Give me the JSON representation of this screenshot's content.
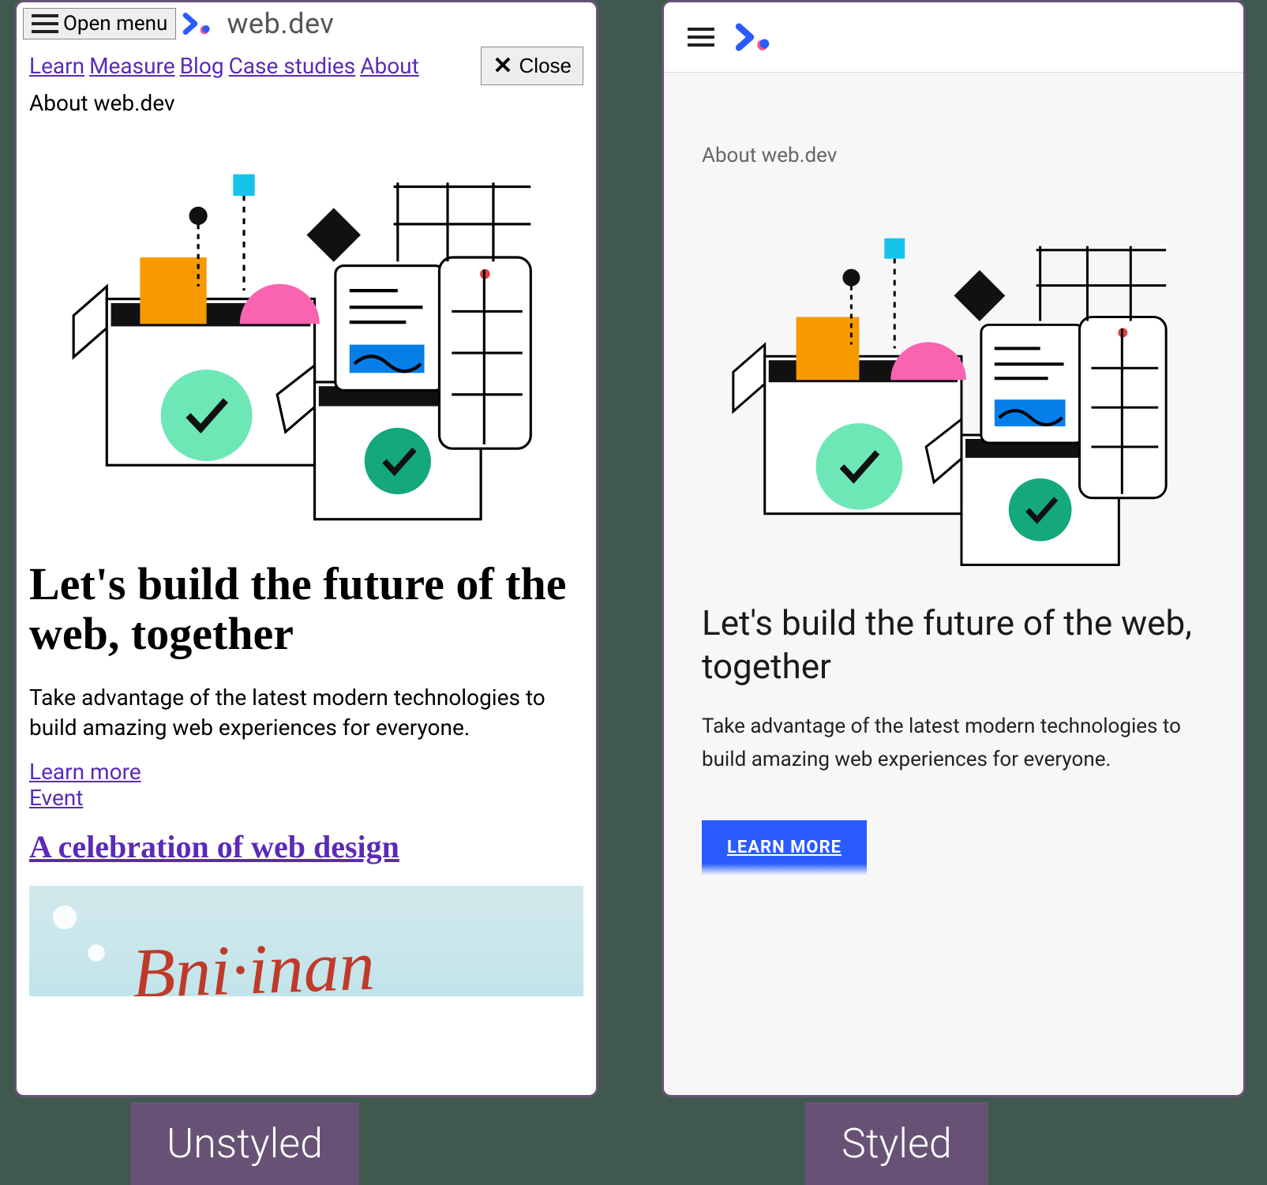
{
  "unstyled": {
    "open_menu_label": "Open menu",
    "logo_text": "web.dev",
    "nav": [
      "Learn",
      "Measure",
      "Blog",
      "Case studies",
      "About"
    ],
    "close_label": "Close",
    "about_label": "About web.dev",
    "heading": "Let's build the future of the web, together",
    "subheading": "Take advantage of the latest modern technologies to build amazing web experiences for everyone.",
    "links": [
      "Learn more",
      "Event"
    ],
    "section_heading": "A celebration of web design"
  },
  "styled": {
    "about_label": "About web.dev",
    "heading": "Let's build the future of the web, together",
    "subheading": "Take advantage of the latest modern technologies to build amazing web experiences for everyone.",
    "cta": "LEARN MORE"
  },
  "captions": {
    "left": "Unstyled",
    "right": "Styled"
  }
}
